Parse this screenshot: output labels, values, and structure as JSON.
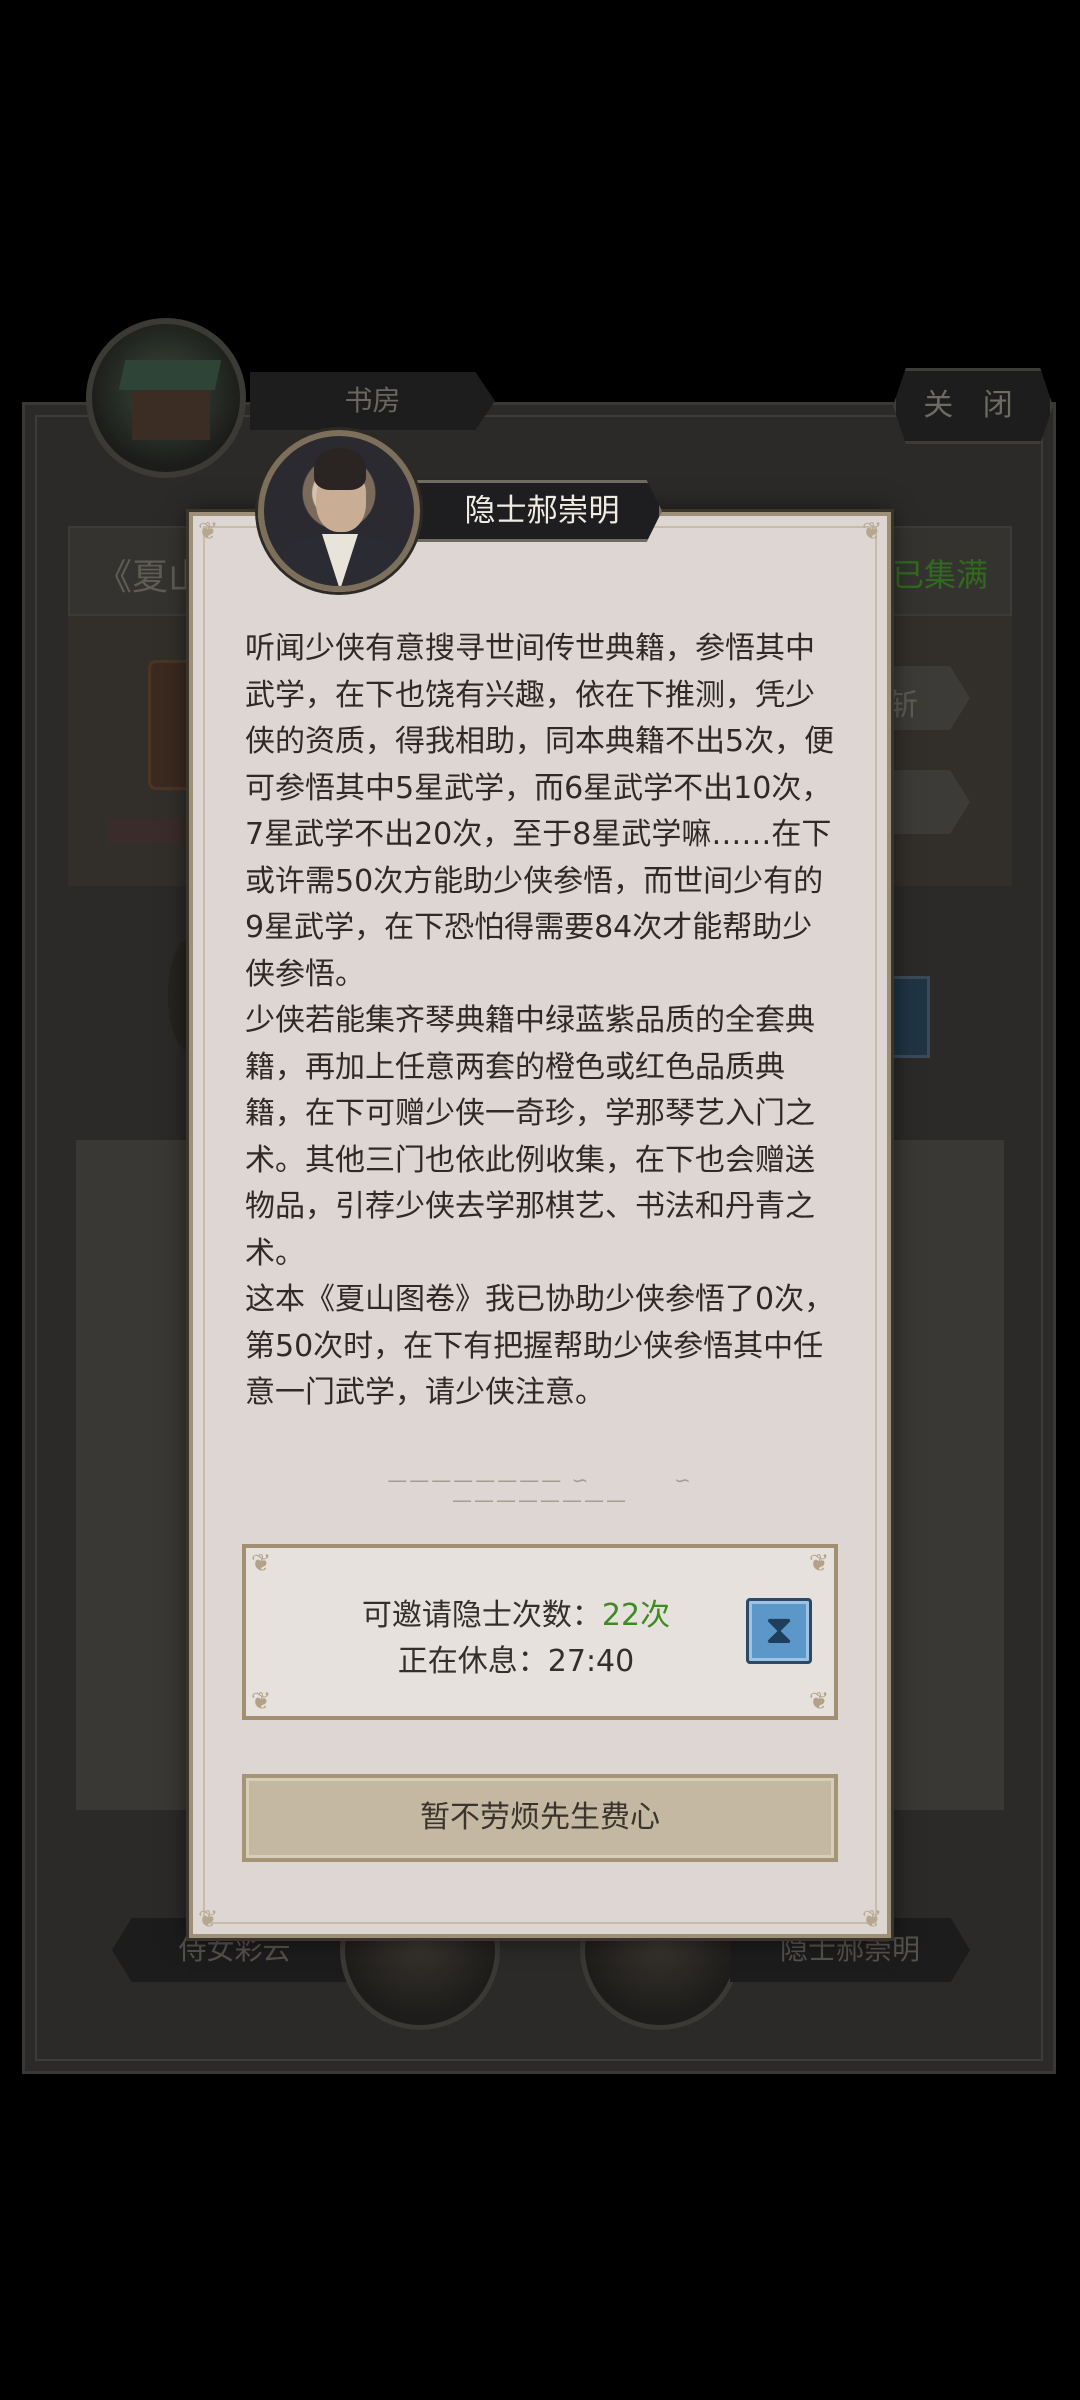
{
  "background": {
    "room_tab": "书房",
    "close_button": "关 闭",
    "book_title": "《夏山",
    "book_status": "已集满",
    "side_button": "斩",
    "left_character": "侍女彩云",
    "right_character": "隐士郝崇明"
  },
  "dialog": {
    "speaker": "隐士郝崇明",
    "text": "听闻少侠有意搜寻世间传世典籍，参悟其中武学，在下也饶有兴趣，依在下推测，凭少侠的资质，得我相助，同本典籍不出5次，便可参悟其中5星武学，而6星武学不出10次，7星武学不出20次，至于8星武学嘛……在下或许需50次方能助少侠参悟，而世间少有的9星武学，在下恐怕得需要84次才能帮助少侠参悟。\n少侠若能集齐琴典籍中绿蓝紫品质的全套典籍，再加上任意两套的橙色或红色品质典籍，在下可赠少侠一奇珍，学那琴艺入门之术。其他三门也依此例收集，在下也会赠送物品，引荐少侠去学那棋艺、书法和丹青之术。\n这本《夏山图卷》我已协助少侠参悟了0次，第50次时，在下有把握帮助少侠参悟其中任意一门武学，请少侠注意。",
    "invite_label": "可邀请隐士次数：",
    "invite_value": "22次",
    "rest_label": "正在休息：27:40",
    "decline_button": "暂不劳烦先生费心"
  },
  "icons": {
    "hourglass": "hourglass-icon"
  },
  "colors": {
    "accent_green": "#3f8a22",
    "dialog_bg": "#ddd6d2",
    "hourglass_blue": "#5b97c9"
  }
}
